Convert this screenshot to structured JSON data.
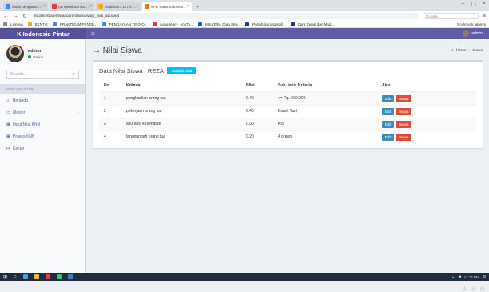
{
  "browser": {
    "tabs": [
      {
        "label": "Mulai pengaturan sistem bunu",
        "color": "#4285f4",
        "active": false
      },
      {
        "label": "(3) membuat ikon fitur",
        "color": "#e53935",
        "active": false
      },
      {
        "label": "localhost / 127.0.0.1 / db_fsp",
        "color": "#f6a623",
        "active": false
      },
      {
        "label": "SPK Kartu Indonesia Pintar",
        "color": "#f57c00",
        "active": true
      }
    ],
    "url": "localhost/admin/aduan/nilai/siswa/p_nilai_aduan/4",
    "search_placeholder": "Google",
    "bookmarks": [
      "Lainnya",
      "BENTIK",
      "PRAKTIKUM PENDE...",
      "PENGAYAAN TEKNO...",
      "dying-team - YouTu...",
      "Mau Tahu Cara Stiw...",
      "Portofolio nota Kuli...",
      "Cara Cepat dan Mud..."
    ],
    "bookmarks_other": "Bookmark lainnya"
  },
  "app": {
    "brand": "K Indonesia Pintar",
    "user_top": "admin",
    "user": {
      "name": "admin",
      "status": "Online"
    },
    "search_placeholder": "Search...",
    "menu_header": "MENU MASTER",
    "nav": [
      {
        "label": "Beranda",
        "icon": "home-icon",
        "glyph": "⌂",
        "chevron": false
      },
      {
        "label": "Master",
        "icon": "monitor-icon",
        "glyph": "▭",
        "chevron": true
      },
      {
        "label": "Input Nilai KNN",
        "icon": "table-icon",
        "glyph": "▦",
        "chevron": false
      },
      {
        "label": "Proses KNN",
        "icon": "table-icon",
        "glyph": "▦",
        "chevron": false
      },
      {
        "label": "Keluar",
        "icon": "signout-icon",
        "glyph": "↦",
        "chevron": false
      }
    ]
  },
  "content": {
    "title": "→ Nilai Siswa",
    "breadcrumb": [
      "Home",
      "Siswa"
    ],
    "box_title": "Data Nilai Siswa : REZA",
    "add_button": "Tambah Nilai",
    "table": {
      "headers": [
        "No",
        "Kriteria",
        "Nilai",
        "Sub Jenis Kriteria",
        "Aksi"
      ],
      "rows": [
        {
          "no": "1",
          "kriteria": "penghasilan orang tua",
          "nilai": "0.40",
          "sub": "<= Rp. 500.000"
        },
        {
          "no": "2",
          "kriteria": "pekerjaan orang tua",
          "nilai": "0.40",
          "sub": "Buruh Tani"
        },
        {
          "no": "3",
          "kriteria": "asuransi kesehatan",
          "nilai": "0.30",
          "sub": "KIS"
        },
        {
          "no": "4",
          "kriteria": "tanggungan orang tua",
          "nilai": "0.20",
          "sub": "4 orang"
        }
      ],
      "edit_label": "Edit",
      "delete_label": "Hapus"
    }
  },
  "taskbar": {
    "time": "11:16 PM"
  },
  "colors": {
    "primary": "#605ca8",
    "info": "#00c0ef",
    "edit": "#3c8dbc",
    "delete": "#dd4b39"
  }
}
